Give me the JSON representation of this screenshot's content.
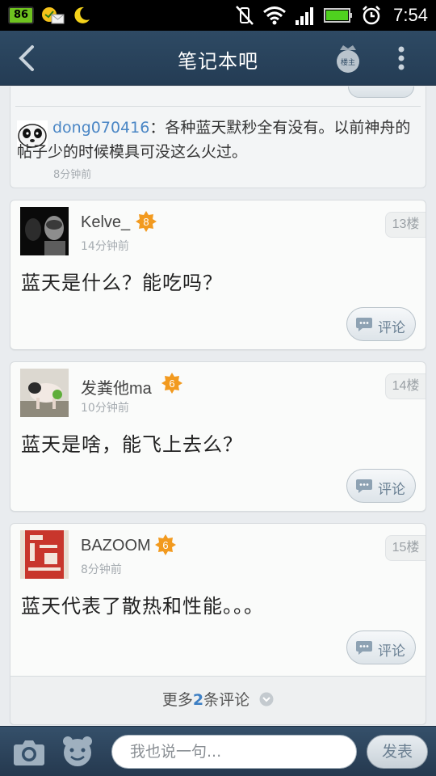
{
  "status_bar": {
    "badge_text": "86",
    "time": "7:54",
    "icons": [
      "sd-card-badge-icon",
      "mail-icon",
      "moon-icon",
      "no-vibrate-icon",
      "wifi-icon",
      "signal-icon",
      "battery-icon",
      "alarm-icon"
    ]
  },
  "header": {
    "title": "笔记本吧",
    "owner_badge_text": "楼主",
    "back_icon": "chevron-left-icon",
    "more_icon": "more-vertical-icon"
  },
  "sub_comment": {
    "user": "dong070416",
    "separator": "：",
    "text": "各种蓝天默秒全有没有。以前神舟的帖子少的时候模具可没这么火过。",
    "time": "8分钟前"
  },
  "posts": [
    {
      "name": "Kelve_",
      "level": "8",
      "time": "14分钟前",
      "floor": "13楼",
      "body": "蓝天是什么？能吃吗？",
      "comment_label": "评论"
    },
    {
      "name": "发粪他ma",
      "level": "6",
      "time": "10分钟前",
      "floor": "14楼",
      "body": "蓝天是啥，能飞上去么？",
      "comment_label": "评论"
    },
    {
      "name": "BAZOOM",
      "level": "6",
      "time": "8分钟前",
      "floor": "15楼",
      "body": "蓝天代表了散热和性能。。。",
      "comment_label": "评论"
    }
  ],
  "more_comments": {
    "prefix": "更多",
    "count": "2",
    "suffix": "条评论"
  },
  "bottom_bar": {
    "input_placeholder": "我也说一句...",
    "send_label": "发表"
  },
  "colors": {
    "header_bg": "#2e4a64",
    "link_blue": "#4a86c5",
    "level_badge": "#f29a1f",
    "page_bg": "#e9ecef"
  }
}
